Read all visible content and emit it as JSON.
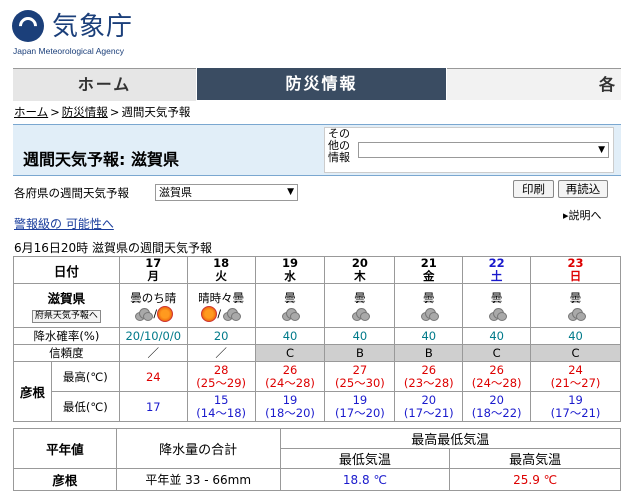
{
  "header": {
    "logo_jp": "気象庁",
    "logo_en": "Japan Meteorological Agency"
  },
  "nav": {
    "home": "ホーム",
    "bosai": "防災情報",
    "third": "各"
  },
  "breadcrumb": {
    "home": "ホーム",
    "bosai": "防災情報",
    "current": "週間天気予報",
    "sep": ">"
  },
  "title": "週間天気予報: 滋賀県",
  "other_info": {
    "label": "その他の情報",
    "value": ""
  },
  "pref_selector": {
    "label": "各府県の週間天気予報",
    "value": "滋賀県"
  },
  "buttons": {
    "print": "印刷",
    "reload": "再読込"
  },
  "explain": "▸説明へ",
  "warning_link": "警報級の 可能性へ",
  "issued": "6月16日20時  滋賀県の週間天気予報",
  "table": {
    "date_label": "日付",
    "region": "滋賀県",
    "region_button": "府県天気予報へ",
    "pop_label": "降水確率(%)",
    "reliability_label": "信頼度",
    "city": "彦根",
    "max_label": "最高(℃)",
    "min_label": "最低(℃)",
    "days": [
      {
        "date": "17",
        "dow": "月",
        "weather": "曇のち晴",
        "icons": [
          "cloud",
          "sun"
        ],
        "pop": "20/10/0/0",
        "rel": "／",
        "max": "24",
        "max_range": "",
        "min": "17",
        "min_range": ""
      },
      {
        "date": "18",
        "dow": "火",
        "weather": "晴時々曇",
        "icons": [
          "sun",
          "cloud"
        ],
        "pop": "20",
        "rel": "／",
        "max": "28",
        "max_range": "(25〜29)",
        "min": "15",
        "min_range": "(14〜18)"
      },
      {
        "date": "19",
        "dow": "水",
        "weather": "曇",
        "icons": [
          "cloud"
        ],
        "pop": "40",
        "rel": "C",
        "max": "26",
        "max_range": "(24〜28)",
        "min": "19",
        "min_range": "(18〜20)"
      },
      {
        "date": "20",
        "dow": "木",
        "weather": "曇",
        "icons": [
          "cloud"
        ],
        "pop": "40",
        "rel": "B",
        "max": "27",
        "max_range": "(25〜30)",
        "min": "19",
        "min_range": "(17〜20)"
      },
      {
        "date": "21",
        "dow": "金",
        "weather": "曇",
        "icons": [
          "cloud"
        ],
        "pop": "40",
        "rel": "B",
        "max": "26",
        "max_range": "(23〜28)",
        "min": "20",
        "min_range": "(17〜21)"
      },
      {
        "date": "22",
        "dow": "土",
        "weather": "曇",
        "icons": [
          "cloud"
        ],
        "pop": "40",
        "rel": "C",
        "max": "26",
        "max_range": "(24〜28)",
        "min": "20",
        "min_range": "(18〜22)"
      },
      {
        "date": "23",
        "dow": "日",
        "weather": "曇",
        "icons": [
          "cloud"
        ],
        "pop": "40",
        "rel": "C",
        "max": "24",
        "max_range": "(21〜27)",
        "min": "19",
        "min_range": "(17〜21)"
      }
    ]
  },
  "normals": {
    "label": "平年値",
    "precip_label": "降水量の合計",
    "temp_label": "最高最低気温",
    "min_label": "最低気温",
    "max_label": "最高気温",
    "city": "彦根",
    "precip": "平年並 33 - 66mm",
    "min": "18.8 ℃",
    "max": "25.9 ℃"
  }
}
